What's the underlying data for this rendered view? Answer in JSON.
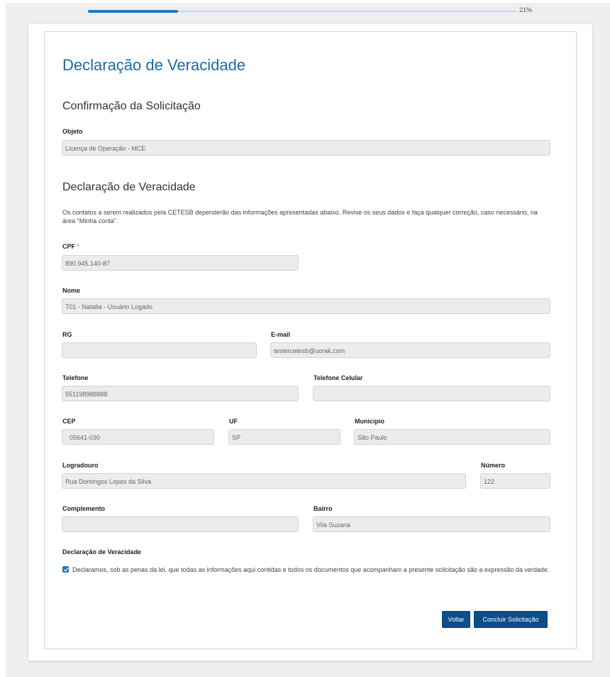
{
  "progress": {
    "percent_label": "21%",
    "value": 0.21
  },
  "page_title": "Declaração de Veracidade",
  "confirmation": {
    "title": "Confirmação da Solicitação",
    "objeto_label": "Objeto",
    "objeto_value": "Licença de Operação - MCE"
  },
  "declaration": {
    "title": "Declaração de Veracidade",
    "description": "Os contatos a serem realizados pela CETESB dependerão das informações apresentadas abaixo. Revise os seus dados e faça qualquer correção, caso necessário, na área \"Minha conta\"."
  },
  "fields": {
    "cpf": {
      "label": "CPF",
      "required_mark": "*",
      "value": "890.945.140-87"
    },
    "nome": {
      "label": "Nome",
      "value": "T01 - Natalia - Usuário Logado"
    },
    "rg": {
      "label": "RG",
      "value": ""
    },
    "email": {
      "label": "E-mail",
      "value": "testercetesb@uorak.com"
    },
    "telefone": {
      "label": "Telefone",
      "value": "551198988888"
    },
    "celular": {
      "label": "Telefone Celular",
      "value": ""
    },
    "cep": {
      "label": "CEP",
      "value": "05641-030"
    },
    "uf": {
      "label": "UF",
      "value": "SP"
    },
    "municipio": {
      "label": "Município",
      "value": "São Paulo"
    },
    "logradouro": {
      "label": "Logradouro",
      "value": "Rua Domingos Lopes da Silva"
    },
    "numero": {
      "label": "Número",
      "value": "122"
    },
    "complemento": {
      "label": "Complemento",
      "value": ""
    },
    "bairro": {
      "label": "Bairro",
      "value": "Vila Suzana"
    }
  },
  "veracity": {
    "label": "Declaração de Veracidade",
    "checked": true,
    "text": "Declaramos, sob as penas da lei, que todas as informações aqui contidas e todos os documentos que acompanham a presente solicitação são a expressão da verdade."
  },
  "buttons": {
    "back": "Voltar",
    "submit": "Concluir Solicitação"
  },
  "colors": {
    "accent": "#1f78c1",
    "button": "#0b4e8a",
    "title": "#1d6aa5"
  }
}
